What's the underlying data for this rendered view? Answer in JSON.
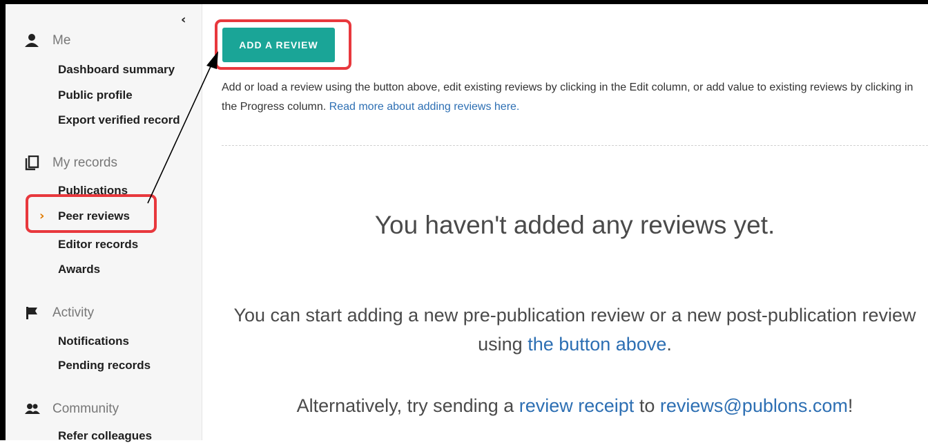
{
  "sidebar": {
    "collapse_glyph": "‹",
    "sections": {
      "me": {
        "title": "Me",
        "icon": "person-icon"
      },
      "records": {
        "title": "My records",
        "icon": "copy-icon"
      },
      "activity": {
        "title": "Activity",
        "icon": "flag-icon"
      },
      "community": {
        "title": "Community",
        "icon": "people-icon"
      }
    },
    "links": {
      "dashboard": "Dashboard summary",
      "public_profile": "Public profile",
      "export": "Export verified record",
      "publications": "Publications",
      "peer_reviews": "Peer reviews",
      "editor_records": "Editor records",
      "awards": "Awards",
      "notifications": "Notifications",
      "pending": "Pending records",
      "refer": "Refer colleagues"
    },
    "active_item": "Peer reviews"
  },
  "main": {
    "add_button": "ADD A REVIEW",
    "intro_text": "Add or load a review using the button above, edit existing reviews by clicking in the Edit column, or add value to existing reviews by clicking in the Progress column.",
    "intro_link": "Read more about adding reviews here.",
    "empty_title": "You haven't added any reviews yet.",
    "msg1_before": "You can start adding a new pre-publication review or a new post-publication review using",
    "msg1_link": "the button above",
    "msg1_after": ".",
    "msg2_before": "Alternatively, try sending a",
    "msg2_link1": "review receipt",
    "msg2_mid": "to",
    "msg2_link2": "reviews@publons.com",
    "msg2_after": "!"
  },
  "colors": {
    "accent": "#1aa597",
    "highlight": "#e8383d",
    "link": "#2d6fb3",
    "active_chevron": "#e07a00"
  }
}
